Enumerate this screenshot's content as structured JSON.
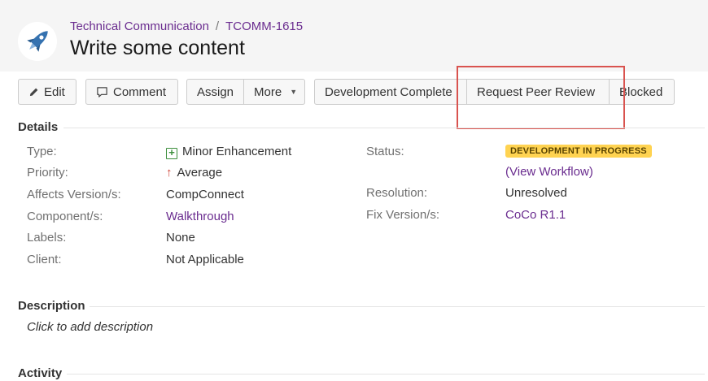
{
  "header": {
    "project": "Technical Communication",
    "separator": "/",
    "issue_key": "TCOMM-1615",
    "title": "Write some content"
  },
  "toolbar": {
    "edit": "Edit",
    "comment": "Comment",
    "assign": "Assign",
    "more": "More",
    "development_complete": "Development Complete",
    "request_peer_review": "Request Peer Review",
    "blocked": "Blocked"
  },
  "details": {
    "heading": "Details",
    "type_label": "Type:",
    "type_value": "Minor Enhancement",
    "priority_label": "Priority:",
    "priority_value": "Average",
    "affects_label": "Affects Version/s:",
    "affects_value": "CompConnect",
    "component_label": "Component/s:",
    "component_value": "Walkthrough",
    "labels_label": "Labels:",
    "labels_value": "None",
    "client_label": "Client:",
    "client_value": "Not Applicable",
    "status_label": "Status:",
    "status_value": "DEVELOPMENT IN PROGRESS",
    "workflow_open": "(",
    "workflow_link": "View Workflow",
    "workflow_close": ")",
    "resolution_label": "Resolution:",
    "resolution_value": "Unresolved",
    "fix_label": "Fix Version/s:",
    "fix_value": "CoCo R1.1"
  },
  "description": {
    "heading": "Description",
    "placeholder": "Click to add description"
  },
  "activity": {
    "heading": "Activity"
  },
  "icons": {
    "avatar": "rocket-icon",
    "edit": "pencil-icon",
    "comment": "speech-bubble-icon",
    "more": "chevron-down-icon",
    "type": "plus-square-icon",
    "priority": "arrow-up-icon"
  },
  "colors": {
    "link": "#6a2c8f",
    "lozenge_bg": "#ffd351",
    "highlight": "#d9534f",
    "rocket": "#3572b0"
  }
}
